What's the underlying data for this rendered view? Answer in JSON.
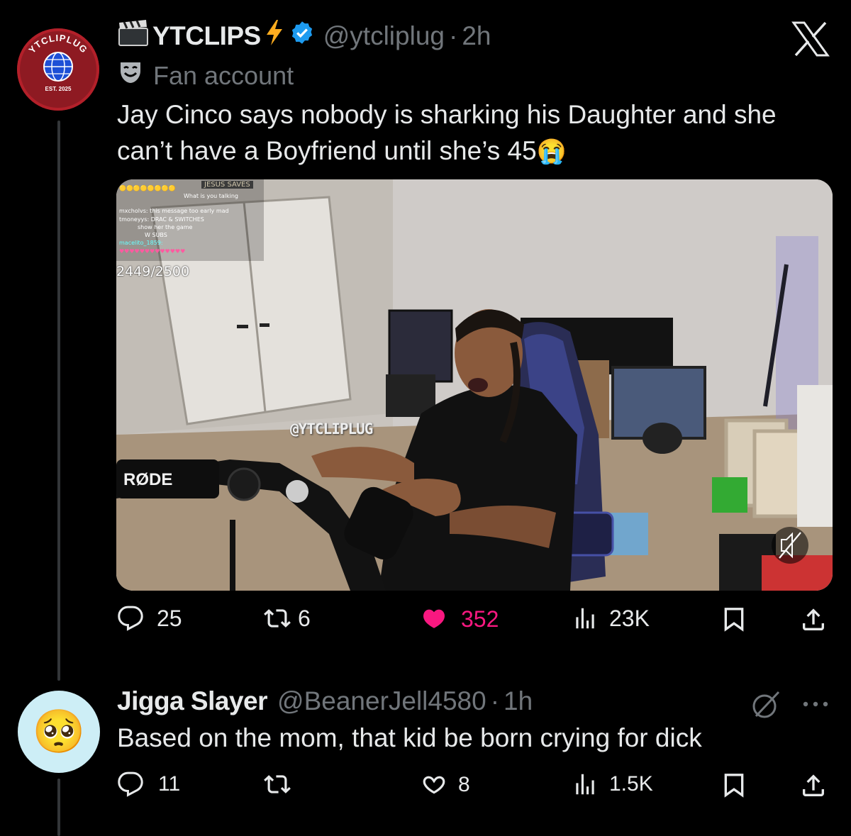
{
  "post": {
    "display_name": "YTCLIPS",
    "handle": "@ytcliplug",
    "time": "2h",
    "label": "Fan account",
    "text": "Jay Cinco says nobody is sharking his Daughter and she can’t have a Boyfriend until she’s 45",
    "emoji": "😭",
    "avatar_text_top": "YTCLIPLUG",
    "avatar_text_bottom": "EST. 2025",
    "stats": {
      "replies": "25",
      "reposts": "6",
      "likes": "352",
      "views": "23K"
    }
  },
  "video": {
    "watermark": "@YTCLIPLUG",
    "sub_counter": "2449/2500",
    "mic_brand": "RØDE",
    "sign": "JESUS SAVES",
    "chat": [
      "What is you talking",
      "mxcholvs: this message too early mad",
      "tmoneyys: DRAC & SWITCHES",
      "show her the game",
      "W SUBS",
      "macelito_1859:"
    ]
  },
  "reply": {
    "display_name": "Jigga Slayer",
    "handle": "@BeanerJell4580",
    "time": "1h",
    "text": "Based on the mom, that kid be born crying for dick",
    "avatar_emoji": "🥺",
    "stats": {
      "replies": "11",
      "likes": "8",
      "views": "1.5K"
    }
  },
  "colors": {
    "background": "#000000",
    "text": "#e7e9ea",
    "muted": "#71767b",
    "like_active": "#f91880",
    "verified": "#1d9bf0",
    "lightning": "#ffad1f"
  },
  "icons": [
    "clapper-icon",
    "lightning-icon",
    "verified-badge-icon",
    "x-logo-icon",
    "fan-account-mask-icon",
    "reply-icon",
    "repost-icon",
    "like-icon",
    "views-icon",
    "bookmark-icon",
    "share-icon",
    "grok-icon",
    "more-icon",
    "mute-icon"
  ]
}
